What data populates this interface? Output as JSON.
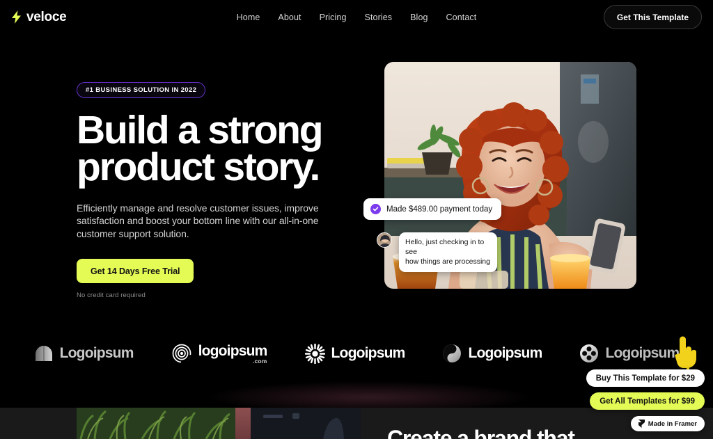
{
  "brand": {
    "name": "veloce",
    "icon": "lightning-bolt-icon",
    "accent": "#e4fa55"
  },
  "nav": {
    "links": [
      {
        "label": "Home"
      },
      {
        "label": "About"
      },
      {
        "label": "Pricing"
      },
      {
        "label": "Stories"
      },
      {
        "label": "Blog"
      },
      {
        "label": "Contact"
      }
    ],
    "cta_label": "Get This Template"
  },
  "hero": {
    "badge": "#1 BUSINESS SOLUTION IN 2022",
    "badge_border_color": "#6331c9",
    "headline_line1": "Build a strong",
    "headline_line2": "product story.",
    "subcopy": "Efficiently manage and resolve customer issues, improve satisfaction and boost your bottom line with our all-in-one customer support solution.",
    "cta_label": "Get 14 Days Free Trial",
    "cta_color": "#e4fa55",
    "cta_note": "No credit card required",
    "image_alt": "smiling-woman-with-red-curly-hair-holding-phone"
  },
  "notifications": {
    "payment": {
      "icon": "check-circle-icon",
      "icon_color": "#7c3aed",
      "text": "Made $489.00 payment today"
    },
    "chat": {
      "avatar": "user-avatar",
      "line1": "Hello, just checking in to see",
      "line2": "how things are processing"
    }
  },
  "logos": [
    {
      "name": "Logoipsum",
      "icon": "arch-mark-icon",
      "suffix": ""
    },
    {
      "name": "logoipsum",
      "icon": "spiral-target-icon",
      "suffix": ".com"
    },
    {
      "name": "Logoipsum",
      "icon": "sunburst-icon",
      "suffix": ""
    },
    {
      "name": "Logoipsum",
      "icon": "yin-yang-swirl-icon",
      "suffix": ""
    },
    {
      "name": "Logoipsum",
      "icon": "four-dot-circle-icon",
      "suffix": ""
    }
  ],
  "bottom": {
    "heading": "Create a brand that",
    "image_left_alt": "green-grass-plants",
    "image_right_alt": "dark-scene"
  },
  "framer_widgets": {
    "buy_label": "Buy This Template for $29",
    "all_label": "Get All Templates for $99",
    "made_in_label": "Made in Framer",
    "made_in_icon": "framer-icon",
    "cursor": "pointing-hand-cursor"
  }
}
